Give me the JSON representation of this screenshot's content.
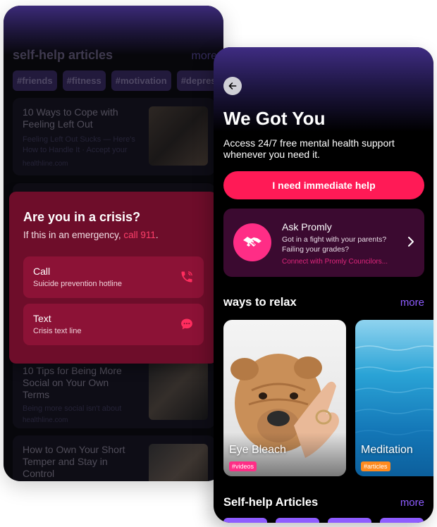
{
  "back_screen": {
    "section_title": "self-help articles",
    "more_label": "more",
    "chips": [
      "#friends",
      "#fitness",
      "#motivation",
      "#depres"
    ],
    "articles": [
      {
        "title": "10 Ways to Cope with Feeling Left Out",
        "snippet": "Feeling Left Out Sucks — Here's How to Handle It · Accept your",
        "source": "healthline.com"
      },
      {
        "title": "10 Tips for Being More Social on Your Own Terms",
        "snippet": "Being more social isn't about",
        "source": "healthline.com"
      },
      {
        "title": "How to Own Your Short Temper and Stay in Control"
      }
    ],
    "crisis": {
      "title": "Are you in a crisis?",
      "subtitle_prefix": "If this in an emergency,",
      "subtitle_link": "call 911",
      "subtitle_suffix": ".",
      "options": [
        {
          "title": "Call",
          "subtitle": "Suicide prevention hotline",
          "icon": "phone-icon"
        },
        {
          "title": "Text",
          "subtitle": "Crisis text line",
          "icon": "chat-icon"
        }
      ]
    }
  },
  "front_screen": {
    "title": "We Got You",
    "subtitle": "Access 24/7 free mental health support whenever you need it.",
    "help_button": "I need immediate help",
    "promly": {
      "title": "Ask Promly",
      "line1": "Got in a fight with your parents?",
      "line2": "Failing your grades?",
      "link": "Connect with Promly Councilors..."
    },
    "relax": {
      "section_title": "ways to relax",
      "more_label": "more",
      "cards": [
        {
          "label": "Eye Bleach",
          "tag": "#videos"
        },
        {
          "label": "Meditation",
          "tag": "#articles"
        }
      ]
    },
    "articles": {
      "section_title": "Self-help Articles",
      "more_label": "more"
    }
  },
  "colors": {
    "accent_pink": "#ff1a56",
    "accent_purple": "#8e5cff",
    "crisis_red": "#6e0d2a",
    "promly_pink": "#ff2d86"
  }
}
